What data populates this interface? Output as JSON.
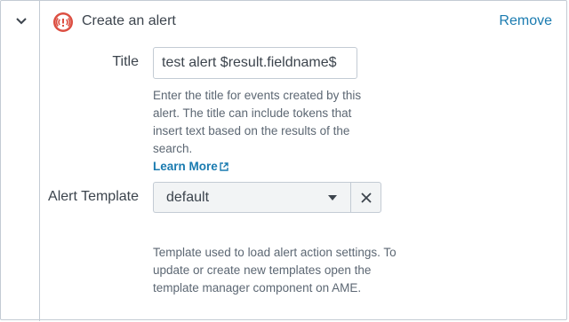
{
  "header": {
    "title": "Create an alert",
    "remove_label": "Remove",
    "alert_icon": "alert-siren-icon",
    "collapse_icon": "chevron-down-icon",
    "accent_color": "#dc4e41",
    "link_color": "#1a7bb0"
  },
  "title_field": {
    "label": "Title",
    "value": "test alert $result.fieldname$",
    "help": "Enter the title for events created by this alert. The title can include tokens that insert text based on the results of the search.",
    "learn_more": "Learn More",
    "learn_more_icon": "external-link-icon"
  },
  "template_field": {
    "label": "Alert Template",
    "selected": "default",
    "dropdown_icon": "caret-down-icon",
    "clear_icon": "close-icon",
    "help": "Template used to load alert action settings. To update or create new templates open the template manager component on AME."
  }
}
